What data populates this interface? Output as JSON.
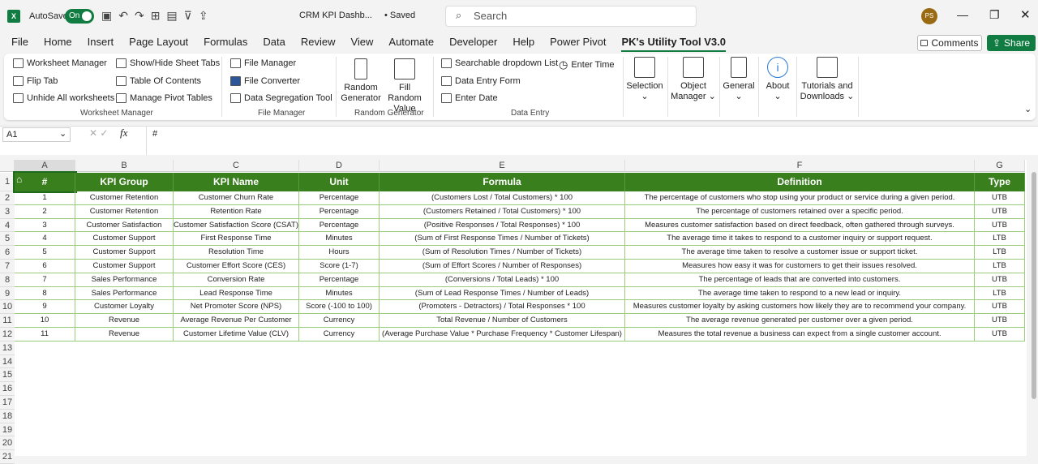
{
  "titlebar": {
    "autosave": "AutoSave",
    "toggle": "On",
    "filename": "CRM KPI Dashb...",
    "saved": "• Saved",
    "search_placeholder": "Search",
    "avatar": "PS"
  },
  "menu": [
    "File",
    "Home",
    "Insert",
    "Page Layout",
    "Formulas",
    "Data",
    "Review",
    "View",
    "Automate",
    "Developer",
    "Help",
    "Power Pivot",
    "PK's Utility Tool V3.0"
  ],
  "actions": {
    "comments": "Comments",
    "share": "Share"
  },
  "ribbon": {
    "worksheet_manager": {
      "items": [
        "Worksheet Manager",
        "Show/Hide Sheet Tabs",
        "Flip Tab",
        "Table Of Contents",
        "Unhide All worksheets",
        "Manage Pivot Tables"
      ],
      "label": "Worksheet Manager"
    },
    "file_manager": {
      "items": [
        "File Manager",
        "File Converter",
        "Data Segregation Tool"
      ],
      "label": "File Manager"
    },
    "random_generator": {
      "items": [
        "Random Generator",
        "Fill Random Value"
      ],
      "label": "Random Generator"
    },
    "data_entry": {
      "items": [
        "Searchable dropdown List",
        "Enter Time",
        "Data Entry Form",
        "Enter Date"
      ],
      "label": "Data Entry"
    },
    "big": [
      "Selection",
      "Object Manager",
      "General",
      "About",
      "Tutorials and Downloads"
    ]
  },
  "formula_bar": {
    "name_box": "A1",
    "fx": "fx",
    "value": "#"
  },
  "columns": [
    "A",
    "B",
    "C",
    "D",
    "E",
    "F",
    "G"
  ],
  "headers": [
    "#",
    "KPI Group",
    "KPI Name",
    "Unit",
    "Formula",
    "Definition",
    "Type"
  ],
  "rows": [
    [
      "1",
      "Customer Retention",
      "Customer Churn Rate",
      "Percentage",
      "(Customers Lost / Total Customers) * 100",
      "The percentage of customers who stop using your product or service during a given period.",
      "UTB"
    ],
    [
      "2",
      "Customer Retention",
      "Retention Rate",
      "Percentage",
      "(Customers Retained / Total Customers) * 100",
      "The percentage of customers retained over a specific period.",
      "UTB"
    ],
    [
      "3",
      "Customer Satisfaction",
      "Customer Satisfaction Score (CSAT)",
      "Percentage",
      "(Positive Responses / Total Responses) * 100",
      "Measures customer satisfaction based on direct feedback, often gathered through surveys.",
      "UTB"
    ],
    [
      "4",
      "Customer Support",
      "First Response Time",
      "Minutes",
      "(Sum of First Response Times / Number of Tickets)",
      "The average time it takes to respond to a customer inquiry or support request.",
      "LTB"
    ],
    [
      "5",
      "Customer Support",
      "Resolution Time",
      "Hours",
      "(Sum of Resolution Times / Number of Tickets)",
      "The average time taken to resolve a customer issue or support ticket.",
      "LTB"
    ],
    [
      "6",
      "Customer Support",
      "Customer Effort Score (CES)",
      "Score (1-7)",
      "(Sum of Effort Scores / Number of Responses)",
      "Measures how easy it was for customers to get their issues resolved.",
      "LTB"
    ],
    [
      "7",
      "Sales Performance",
      "Conversion Rate",
      "Percentage",
      "(Conversions / Total Leads) * 100",
      "The percentage of leads that are converted into customers.",
      "UTB"
    ],
    [
      "8",
      "Sales Performance",
      "Lead Response Time",
      "Minutes",
      "(Sum of Lead Response Times / Number of Leads)",
      "The average time taken to respond to a new lead or inquiry.",
      "LTB"
    ],
    [
      "9",
      "Customer Loyalty",
      "Net Promoter Score (NPS)",
      "Score (-100 to 100)",
      "(Promoters - Detractors) / Total Responses * 100",
      "Measures customer loyalty by asking customers how likely they are to recommend your company.",
      "UTB"
    ],
    [
      "10",
      "Revenue",
      "Average Revenue Per Customer",
      "Currency",
      "Total Revenue / Number of Customers",
      "The average revenue generated per customer over a given period.",
      "UTB"
    ],
    [
      "11",
      "Revenue",
      "Customer Lifetime Value (CLV)",
      "Currency",
      "(Average Purchase Value * Purchase Frequency * Customer Lifespan)",
      "Measures the total revenue a business can expect from a single customer account.",
      "UTB"
    ]
  ],
  "row_numbers": [
    "1",
    "2",
    "3",
    "4",
    "5",
    "6",
    "7",
    "8",
    "9",
    "10",
    "11",
    "12",
    "13",
    "14",
    "15",
    "16",
    "17",
    "18",
    "19",
    "20",
    "21"
  ],
  "colors": {
    "header": "#3a7f1e",
    "accent": "#107c41",
    "border": "#9ccc7a"
  }
}
